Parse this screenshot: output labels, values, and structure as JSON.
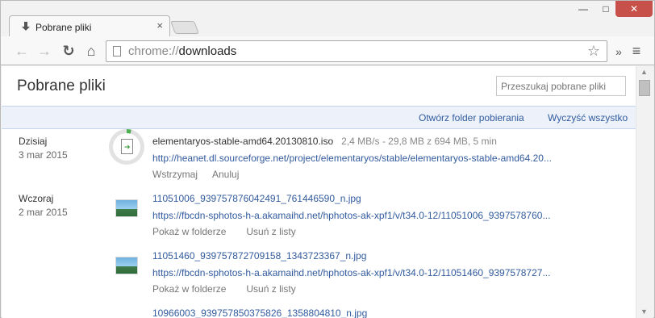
{
  "window": {
    "tab_title": "Pobrane pliki",
    "tab_close": "×",
    "min_label": "—",
    "max_label": "□",
    "close_label": "✕"
  },
  "toolbar": {
    "url_scheme": "chrome://",
    "url_path": "downloads",
    "back_icon": "←",
    "forward_icon": "→",
    "reload_icon": "↻",
    "home_icon": "⌂",
    "star_icon": "☆",
    "ext_icon": "»",
    "menu_icon": "≡"
  },
  "page": {
    "title": "Pobrane pliki",
    "search_placeholder": "Przeszukaj pobrane pliki",
    "open_folder": "Otwórz folder pobierania",
    "clear_all": "Wyczyść wszystko"
  },
  "groups": [
    {
      "day": "Dzisiaj",
      "date": "3 mar 2015"
    },
    {
      "day": "Wczoraj",
      "date": "2 mar 2015"
    }
  ],
  "downloads": [
    {
      "name": "elementaryos-stable-amd64.20130810.iso",
      "status": "2,4 MB/s - 29,8 MB z 694 MB, 5 min",
      "url": "http://heanet.dl.sourceforge.net/project/elementaryos/stable/elementaryos-stable-amd64.20...",
      "action1": "Wstrzymaj",
      "action2": "Anuluj",
      "progress": 0.043
    },
    {
      "name": "11051006_939757876042491_761446590_n.jpg",
      "url": "https://fbcdn-sphotos-h-a.akamaihd.net/hphotos-ak-xpf1/v/t34.0-12/11051006_9397578760...",
      "action1": "Pokaż w folderze",
      "action2": "Usuń z listy"
    },
    {
      "name": "11051460_939757872709158_1343723367_n.jpg",
      "url": "https://fbcdn-sphotos-h-a.akamaihd.net/hphotos-ak-xpf1/v/t34.0-12/11051460_9397578727...",
      "action1": "Pokaż w folderze",
      "action2": "Usuń z listy"
    },
    {
      "name": "10966003_939757850375826_1358804810_n.jpg"
    }
  ]
}
